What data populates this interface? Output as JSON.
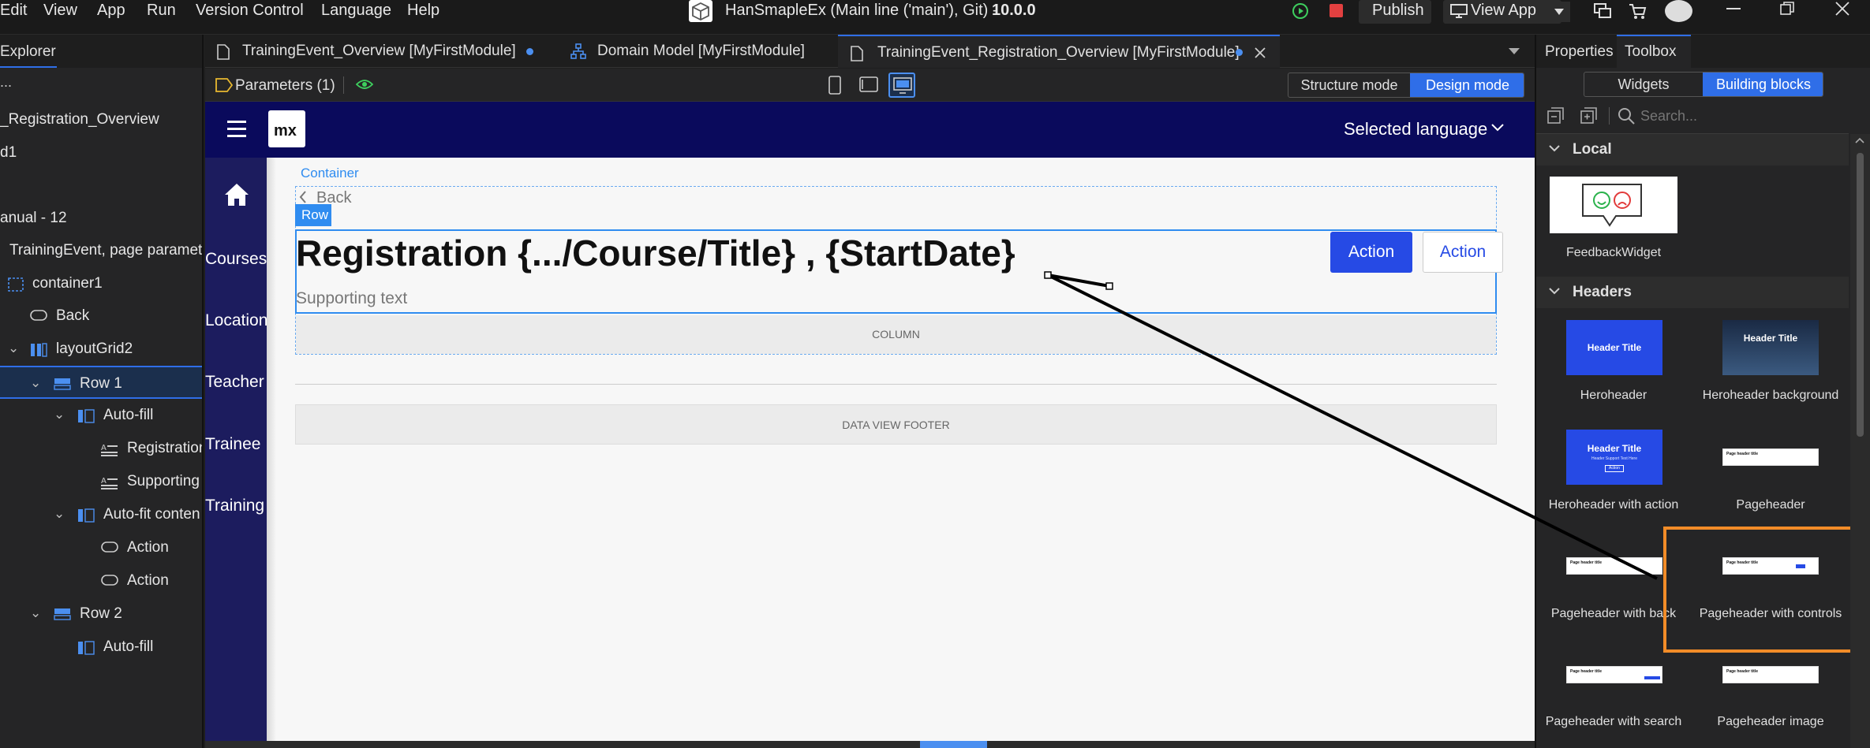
{
  "menubar": {
    "items": [
      "Edit",
      "View",
      "App",
      "Run",
      "Version Control",
      "Language",
      "Help"
    ],
    "app_title": "HanSmapleEx (Main line ('main'), Git)  -",
    "version": "10.0.0",
    "publish": "Publish",
    "view_app": "View App"
  },
  "explorer": {
    "title": "Explorer",
    "filter": "...",
    "rows": [
      {
        "label": "_Registration_Overview"
      },
      {
        "label": "d1"
      },
      {
        "label": "anual - 12"
      },
      {
        "label": "TrainingEvent, page paramete"
      },
      {
        "label": "container1"
      },
      {
        "label": "Back"
      },
      {
        "label": "layoutGrid2"
      },
      {
        "label": "Row 1"
      },
      {
        "label": "Auto-fill"
      },
      {
        "label": "Registration"
      },
      {
        "label": "Supporting"
      },
      {
        "label": "Auto-fit conten"
      },
      {
        "label": "Action"
      },
      {
        "label": "Action"
      },
      {
        "label": "Row 2"
      },
      {
        "label": "Auto-fill"
      }
    ]
  },
  "tabs": [
    {
      "label": "TrainingEvent_Overview [MyFirstModule]"
    },
    {
      "label": "Domain Model [MyFirstModule]"
    },
    {
      "label": "TrainingEvent_Registration_Overview [MyFirstModule]"
    }
  ],
  "subbar": {
    "parameters": "Parameters (1)",
    "structure_mode": "Structure mode",
    "design_mode": "Design mode"
  },
  "canvas": {
    "logo": "mx",
    "selected_language": "Selected language",
    "nav": [
      "Courses",
      "Location",
      "Teacher",
      "Trainee",
      "Training"
    ],
    "container_label": "Container",
    "back_label": "Back",
    "row_label": "Row",
    "heading": "Registration {.../Course/Title} , {StartDate}",
    "supporting": "Supporting text",
    "action_primary": "Action",
    "action_secondary": "Action",
    "column_label": "COLUMN",
    "footer_label": "DATA VIEW FOOTER"
  },
  "rightpanel": {
    "tabs": [
      "Properties",
      "Toolbox"
    ],
    "toggle": [
      "Widgets",
      "Building blocks"
    ],
    "search_placeholder": "Search...",
    "sections": [
      {
        "title": "Local",
        "blocks": [
          "FeedbackWidget"
        ]
      },
      {
        "title": "Headers",
        "blocks": [
          "Heroheader",
          "Heroheader background",
          "Heroheader with action",
          "Pageheader",
          "Pageheader with back",
          "Pageheader with controls",
          "Pageheader with search",
          "Pageheader image"
        ]
      }
    ],
    "thumb_texts": {
      "hero": "Header Title",
      "hero_bg": "Header Title",
      "hero_action": "Header Title",
      "hero_action_sub": "Header Support Text Here",
      "hero_action_btn": "Action",
      "page": "Page header title"
    }
  },
  "colors": {
    "accent": "#2f6ee8",
    "primary_button": "#264ae5",
    "app_header": "#0a0a5c",
    "highlight": "#f28c28"
  }
}
